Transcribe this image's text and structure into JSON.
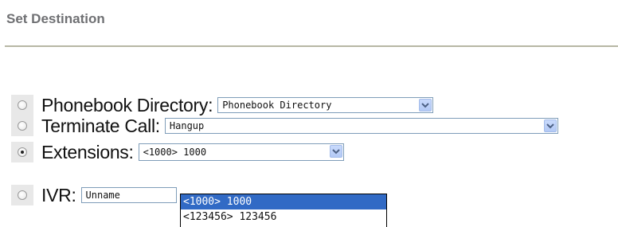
{
  "section": {
    "title": "Set Destination"
  },
  "rows": [
    {
      "label": "Phonebook Directory:",
      "selected": "Phonebook Directory",
      "checked": false
    },
    {
      "label": "Terminate Call:",
      "selected": "Hangup",
      "checked": false
    },
    {
      "label": "Extensions:",
      "selected": "<1000> 1000",
      "checked": true
    },
    {
      "label": "IVR:",
      "selected": "Unname",
      "checked": false
    }
  ],
  "extensions_dropdown": {
    "options": [
      "<1000> 1000",
      "<123456> 123456"
    ],
    "highlighted_index": 0
  },
  "colors": {
    "title": "#6f7073",
    "rule": "#b7b7a4",
    "select_border": "#7f9db9",
    "highlight": "#316ac5"
  }
}
